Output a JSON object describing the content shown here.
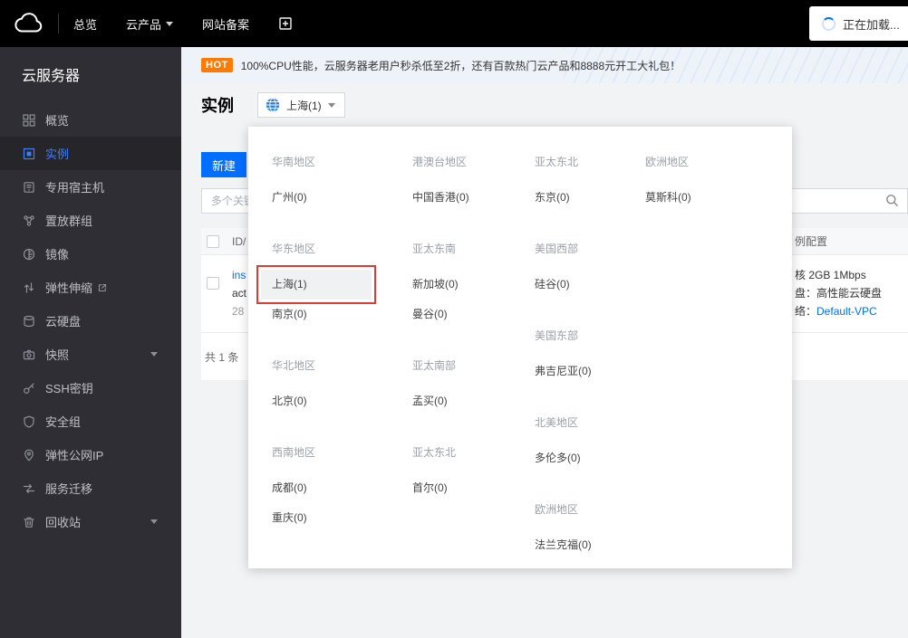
{
  "colors": {
    "accent": "#006eff",
    "highlight_red": "#e23a30",
    "hot_orange": "#ff7a00",
    "topbar_bg": "#000000",
    "sidebar_bg": "#2e2e34"
  },
  "topbar": {
    "nav_overview": "总览",
    "nav_products": "云产品",
    "nav_icp": "网站备案",
    "loading_text": "正在加载..."
  },
  "sidebar": {
    "title": "云服务器",
    "items": [
      {
        "label": "概览"
      },
      {
        "label": "实例"
      },
      {
        "label": "专用宿主机"
      },
      {
        "label": "置放群组"
      },
      {
        "label": "镜像"
      },
      {
        "label": "弹性伸缩"
      },
      {
        "label": "云硬盘"
      },
      {
        "label": "快照"
      },
      {
        "label": "SSH密钥"
      },
      {
        "label": "安全组"
      },
      {
        "label": "弹性公网IP"
      },
      {
        "label": "服务迁移"
      },
      {
        "label": "回收站"
      }
    ]
  },
  "banner": {
    "badge": "HOT",
    "text": "100%CPU性能，云服务器老用户秒杀低至2折，还有百款热门云产品和8888元开工大礼包！"
  },
  "page": {
    "title": "实例",
    "region": "上海(1)"
  },
  "toolbar": {
    "create_label": "新建",
    "search_placeholder": "多个关键"
  },
  "table": {
    "header_id": "ID/",
    "header_config": "例配置",
    "row": {
      "id_text": "ins",
      "name_text": "act",
      "time_text": "28",
      "config_line1": "核 2GB 1Mbps",
      "config_line2": "盘：高性能云硬盘",
      "config_line3_prefix": "络：",
      "vpc_link": "Default-VPC"
    },
    "pagination": "共 1 条"
  },
  "region_dropdown": {
    "col1": {
      "south": {
        "h": "华南地区",
        "items": [
          "广州(0)"
        ]
      },
      "east": {
        "h": "华东地区",
        "items": [
          "上海(1)",
          "南京(0)"
        ]
      },
      "north": {
        "h": "华北地区",
        "items": [
          "北京(0)"
        ]
      },
      "southwest": {
        "h": "西南地区",
        "items": [
          "成都(0)",
          "重庆(0)"
        ]
      }
    },
    "col2": {
      "hmt": {
        "h": "港澳台地区",
        "items": [
          "中国香港(0)"
        ]
      },
      "se_asia": {
        "h": "亚太东南",
        "items": [
          "新加坡(0)",
          "曼谷(0)"
        ]
      },
      "s_asia": {
        "h": "亚太南部",
        "items": [
          "孟买(0)"
        ]
      },
      "ne_asia": {
        "h": "亚太东北",
        "items": [
          "首尔(0)"
        ]
      }
    },
    "col3": {
      "ne_asia": {
        "h": "亚太东北",
        "items": [
          "东京(0)"
        ]
      },
      "us_west": {
        "h": "美国西部",
        "items": [
          "硅谷(0)"
        ]
      },
      "us_east": {
        "h": "美国东部",
        "items": [
          "弗吉尼亚(0)"
        ]
      },
      "na": {
        "h": "北美地区",
        "items": [
          "多伦多(0)"
        ]
      },
      "europe": {
        "h": "欧洲地区",
        "items": [
          "法兰克福(0)"
        ]
      }
    },
    "col4": {
      "europe": {
        "h": "欧洲地区",
        "items": [
          "莫斯科(0)"
        ]
      }
    }
  }
}
